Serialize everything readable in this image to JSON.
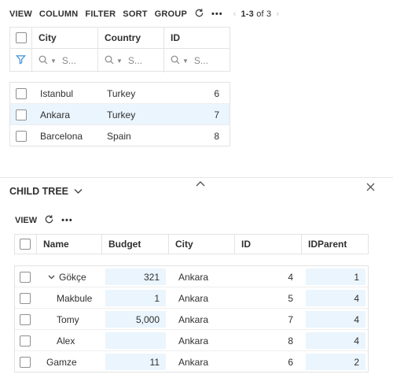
{
  "toolbar": {
    "view": "VIEW",
    "column": "COLUMN",
    "filter": "FILTER",
    "sort": "SORT",
    "group": "GROUP",
    "more": "•••",
    "pager_range": "1-3",
    "pager_of": "of 3"
  },
  "grid": {
    "columns": [
      "City",
      "Country",
      "ID"
    ],
    "filter_placeholder": "S...",
    "rows": [
      {
        "city": "Istanbul",
        "country": "Turkey",
        "id": "6",
        "selected": false
      },
      {
        "city": "Ankara",
        "country": "Turkey",
        "id": "7",
        "selected": true
      },
      {
        "city": "Barcelona",
        "country": "Spain",
        "id": "8",
        "selected": false
      }
    ]
  },
  "child": {
    "title": "CHILD TREE",
    "view": "VIEW",
    "more": "•••",
    "columns": [
      "Name",
      "Budget",
      "City",
      "ID",
      "IDParent"
    ],
    "rows": [
      {
        "name": "Gökçe",
        "budget": "321",
        "city": "Ankara",
        "id": "4",
        "parent": "1",
        "expanded": true
      },
      {
        "name": "Makbule",
        "budget": "1",
        "city": "Ankara",
        "id": "5",
        "parent": "4"
      },
      {
        "name": "Tomy",
        "budget": "5,000",
        "city": "Ankara",
        "id": "7",
        "parent": "4"
      },
      {
        "name": "Alex",
        "budget": "",
        "city": "Ankara",
        "id": "8",
        "parent": "4"
      },
      {
        "name": "Gamze",
        "budget": "11",
        "city": "Ankara",
        "id": "6",
        "parent": "2"
      }
    ]
  },
  "colors": {
    "accent": "#3a8fd8",
    "selected_row": "#eaf5fd",
    "editable_cell": "#eaf5fd"
  }
}
